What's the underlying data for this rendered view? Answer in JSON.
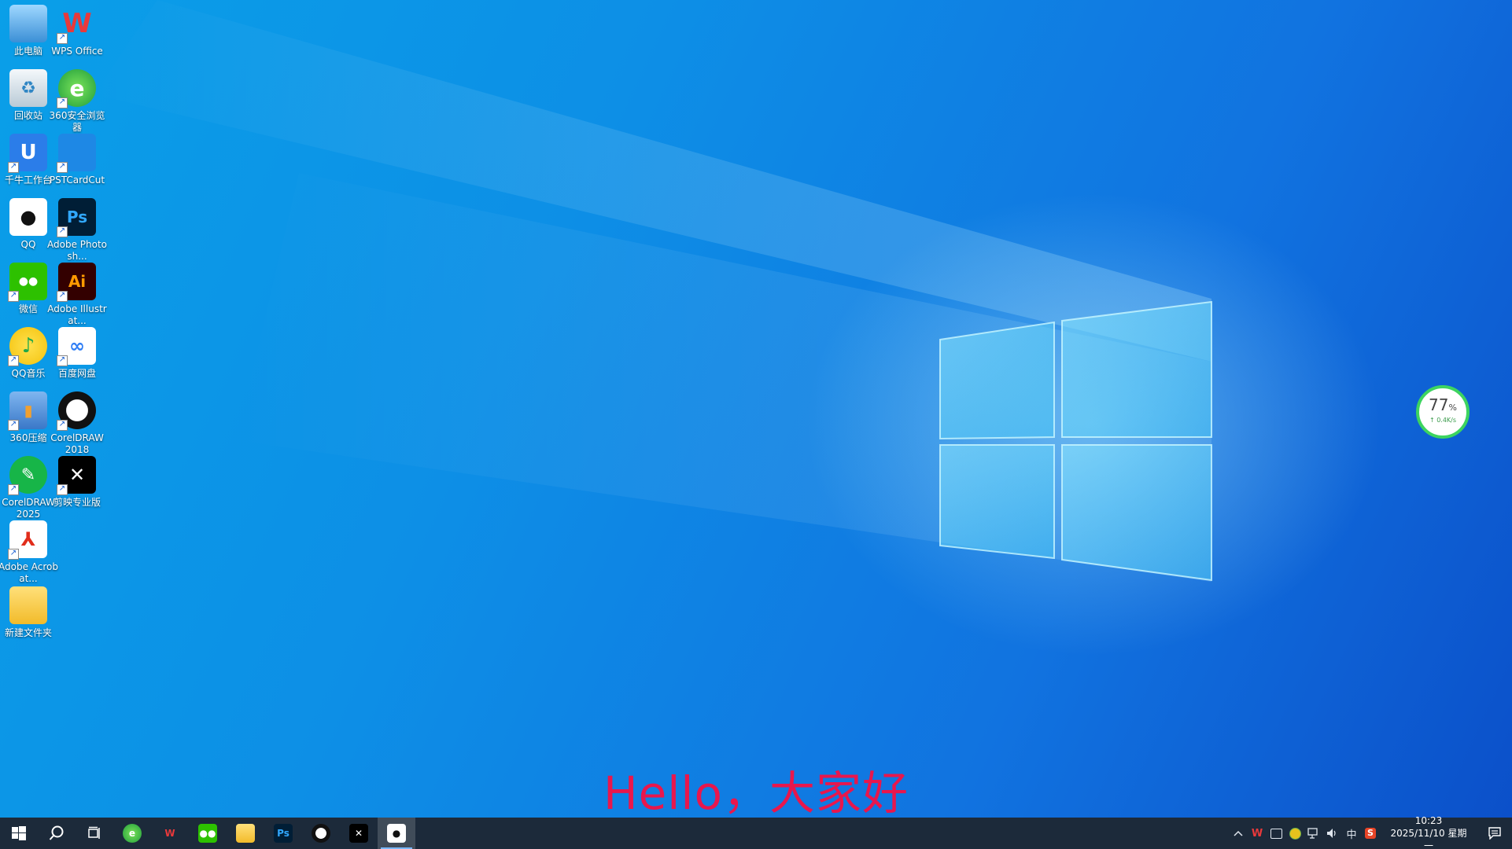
{
  "desktop_icons": [
    {
      "label": "此电脑",
      "icon": "computer-icon",
      "shortcut": false
    },
    {
      "label": "WPS Office",
      "icon": "wps-office-icon",
      "shortcut": true
    },
    {
      "label": "回收站",
      "icon": "recycle-bin-icon",
      "shortcut": false
    },
    {
      "label": "360安全浏览器",
      "icon": "360-browser-icon",
      "shortcut": true
    },
    {
      "label": "千牛工作台",
      "icon": "qianniu-icon",
      "shortcut": true
    },
    {
      "label": "PSTCardCut",
      "icon": "pstcardcut-icon",
      "shortcut": true
    },
    {
      "label": "QQ",
      "icon": "qq-icon",
      "shortcut": false
    },
    {
      "label": "Adobe Photosh...",
      "icon": "photoshop-icon",
      "shortcut": true
    },
    {
      "label": "微信",
      "icon": "wechat-icon",
      "shortcut": true
    },
    {
      "label": "Adobe Illustrat...",
      "icon": "illustrator-icon",
      "shortcut": true
    },
    {
      "label": "QQ音乐",
      "icon": "qq-music-icon",
      "shortcut": true
    },
    {
      "label": "百度网盘",
      "icon": "baidu-netdisk-icon",
      "shortcut": true
    },
    {
      "label": "360压缩",
      "icon": "360-zip-icon",
      "shortcut": true
    },
    {
      "label": "CorelDRAW 2018",
      "icon": "coreldraw-2018-icon",
      "shortcut": true
    },
    {
      "label": "CorelDRAW 2025",
      "icon": "coreldraw-2025-icon",
      "shortcut": true
    },
    {
      "label": "剪映专业版",
      "icon": "capcut-icon",
      "shortcut": true
    },
    {
      "label": "Adobe Acrobat...",
      "icon": "acrobat-icon",
      "shortcut": true
    },
    {
      "label": "新建文件夹",
      "icon": "folder-icon",
      "shortcut": false
    }
  ],
  "net_meter": {
    "percent": "77",
    "percent_unit": "%",
    "speed": "↑ 0.4K/s"
  },
  "caption": "Hello，大家好",
  "taskbar": {
    "start_icon": "windows-start-icon",
    "search_icon": "search-icon",
    "taskview_icon": "task-view-icon",
    "apps": [
      {
        "name": "360-browser",
        "icon": "360-browser-icon"
      },
      {
        "name": "wps-office",
        "icon": "wps-office-icon"
      },
      {
        "name": "wechat",
        "icon": "wechat-icon"
      },
      {
        "name": "file-explorer",
        "icon": "folder-icon"
      },
      {
        "name": "photoshop",
        "icon": "photoshop-icon",
        "text": "Ps"
      },
      {
        "name": "coreldraw",
        "icon": "coreldraw-icon"
      },
      {
        "name": "capcut",
        "icon": "capcut-icon"
      },
      {
        "name": "qq",
        "icon": "qq-icon",
        "active": true
      }
    ],
    "tray": {
      "ime_label": "中",
      "time": "10:23",
      "date": "2025/11/10 星期一"
    }
  },
  "colors": {
    "caption": "#e8174d",
    "taskbar": "#1c2a3a",
    "netmeter_ring": "#3dd45f"
  }
}
